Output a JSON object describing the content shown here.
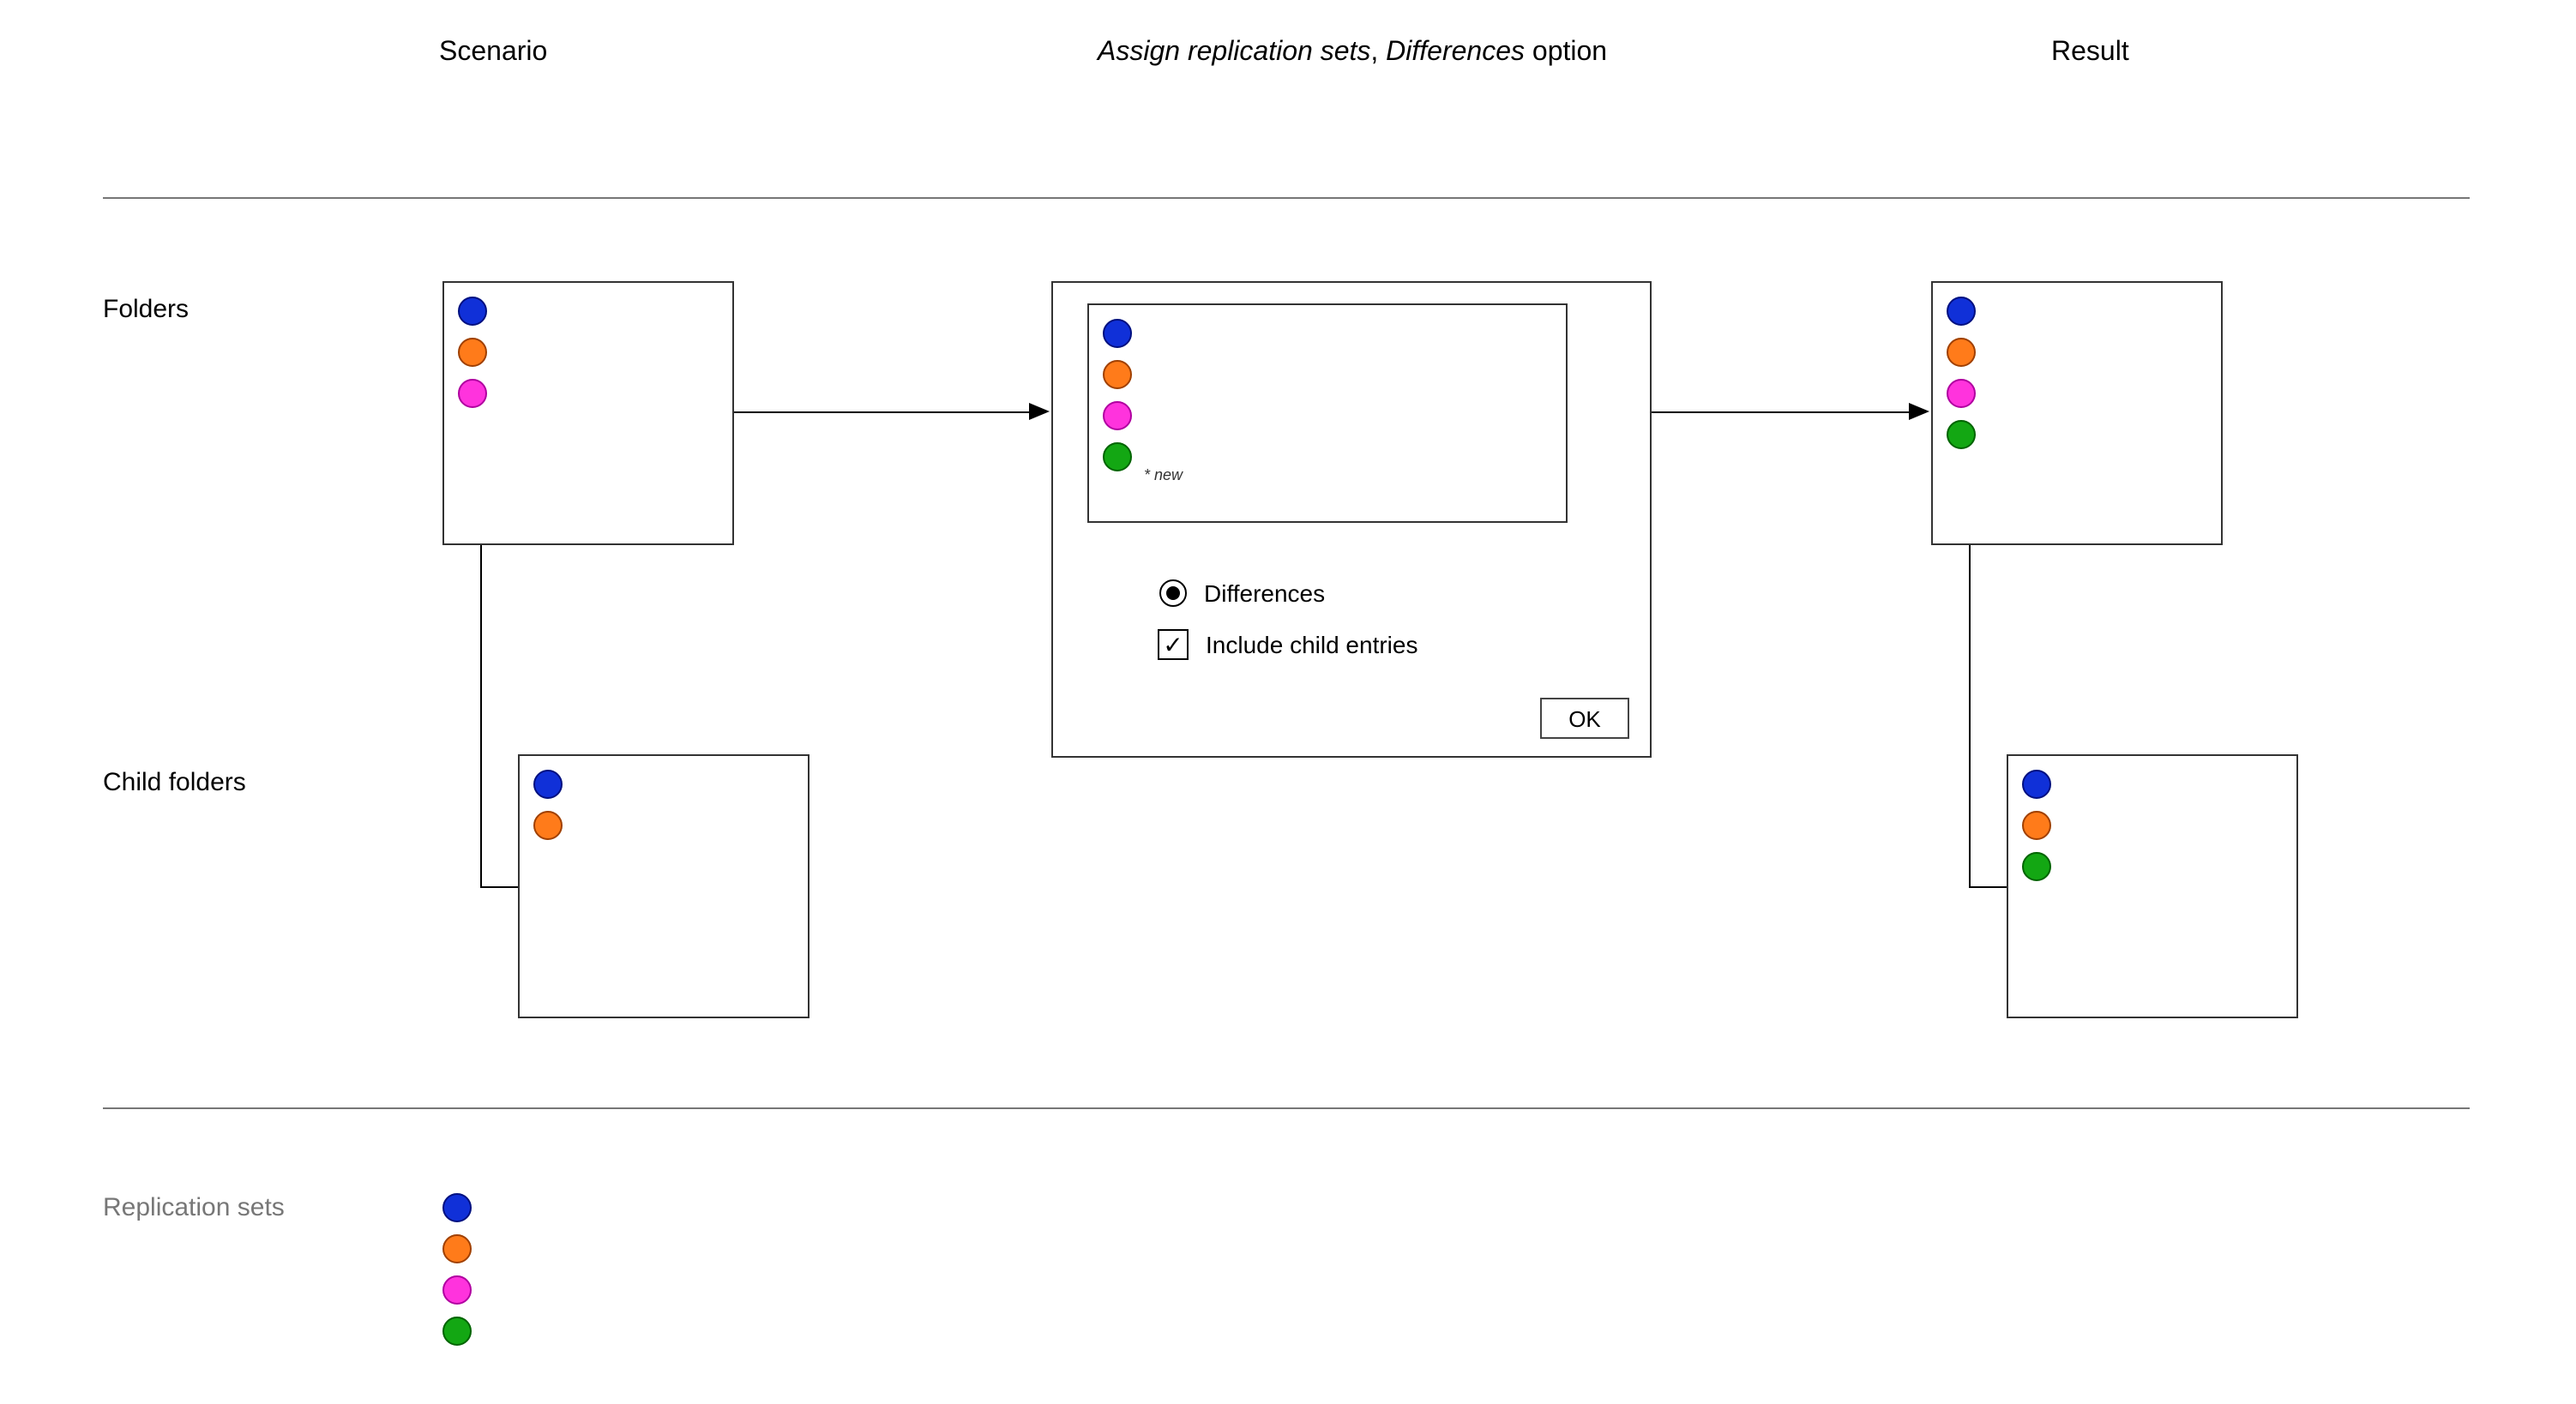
{
  "columns": {
    "scenario": "Scenario",
    "assign_pre": "Assign replication sets",
    "assign_mid": ", ",
    "assign_diff": "Differences",
    "assign_post": " option",
    "result": "Result"
  },
  "rows": {
    "folders": "Folders",
    "child_folders": "Child folders",
    "replication_sets": "Replication sets"
  },
  "dialog": {
    "new_marker": "* new",
    "radio_label": "Differences",
    "checkbox_label": "Include child entries",
    "ok": "OK"
  },
  "colors": {
    "blue": "#1030d8",
    "orange": "#ff7b1a",
    "magenta": "#ff33dd",
    "green": "#13a713"
  },
  "legend_label": "Replication sets",
  "boxes": {
    "scenario_parent_dots": [
      "blue",
      "orange",
      "magenta"
    ],
    "scenario_child_dots": [
      "blue",
      "orange"
    ],
    "dialog_inner_dots": [
      "blue",
      "orange",
      "magenta",
      "green"
    ],
    "result_parent_dots": [
      "blue",
      "orange",
      "magenta",
      "green"
    ],
    "result_child_dots": [
      "blue",
      "orange",
      "green"
    ],
    "legend_dots": [
      "blue",
      "orange",
      "magenta",
      "green"
    ]
  }
}
